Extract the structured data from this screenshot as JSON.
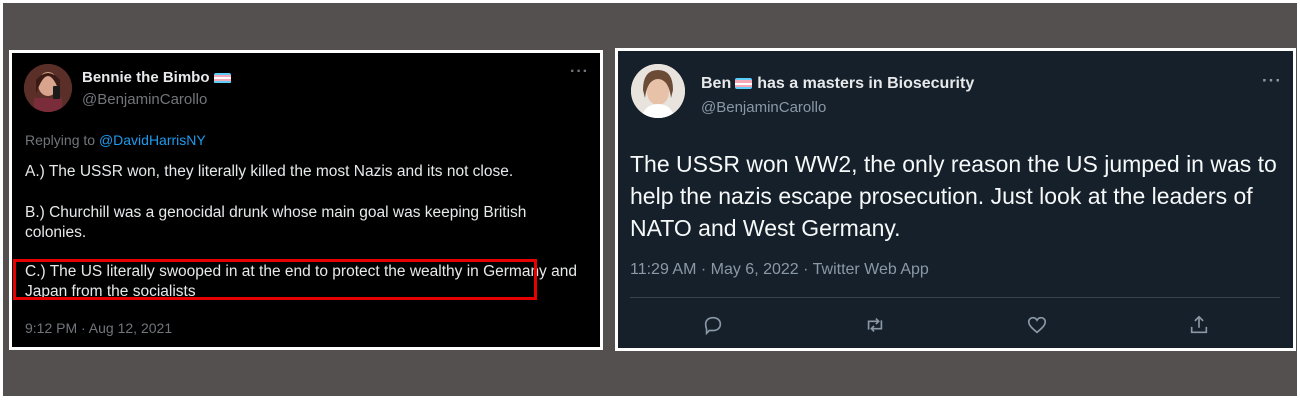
{
  "left_tweet": {
    "display_name": "Bennie the Bimbo",
    "handle": "@BenjaminCarollo",
    "more_label": "···",
    "replying_prefix": "Replying to",
    "replying_to": "@DavidHarrisNY",
    "paragraphs": [
      "A.) The USSR won, they literally killed the most Nazis and its not close.",
      "B.) Churchill was a genocidal drunk whose main goal was keeping British colonies.",
      "C.) The US literally swooped in at the end to protect the wealthy in Germany and Japan from the socialists"
    ],
    "timestamp": "9:12 PM · Aug 12, 2021",
    "highlight_color": "#e60000"
  },
  "right_tweet": {
    "display_name_part1": "Ben",
    "display_name_part2": "has a masters in Biosecurity",
    "handle": "@BenjaminCarollo",
    "more_label": "···",
    "text": "The USSR won WW2, the only reason the US jumped in was to help the nazis escape prosecution. Just look at the leaders of NATO and West Germany.",
    "meta": "11:29 AM · May 6, 2022 · Twitter Web App",
    "actions": [
      "reply-icon",
      "retweet-icon",
      "like-icon",
      "share-icon"
    ]
  },
  "colors": {
    "trans_flag": [
      "#5bcefa",
      "#f5a9b8",
      "#ffffff",
      "#f5a9b8",
      "#5bcefa"
    ],
    "link": "#1d9bf0"
  }
}
